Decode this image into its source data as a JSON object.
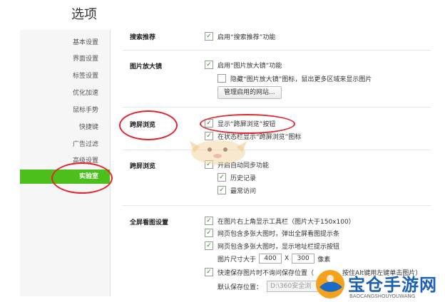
{
  "window": {
    "title": "选项"
  },
  "sidebar": {
    "items": [
      {
        "label": "基本设置"
      },
      {
        "label": "界面设置"
      },
      {
        "label": "标签设置"
      },
      {
        "label": "优化加速"
      },
      {
        "label": "鼠标手势"
      },
      {
        "label": "快捷键"
      },
      {
        "label": "广告过滤"
      },
      {
        "label": "高级设置"
      },
      {
        "label": "实验室",
        "active": true
      }
    ]
  },
  "sections": {
    "search": {
      "title": "搜索推荐",
      "opt1": "启用“搜索推荐”功能"
    },
    "magnifier": {
      "title": "图片放大镜",
      "opt1": "启用“图片放大镜”功能",
      "opt2": "隐藏“图片放大镜”图标，鼠出更多区域来显示图片",
      "button": "管理启用的网站..."
    },
    "crossscreen1": {
      "title": "跨屏浏览",
      "opt1": "显示“跨屏浏览”按钮",
      "opt2": "在状态栏显示“跨屏浏览”图标"
    },
    "crossscreen2": {
      "title": "跨屏浏览",
      "opt1": "开启自动同步功能",
      "opt2": "历史记录",
      "opt3": "最常访问"
    },
    "fullscreen": {
      "title": "全屏看图设置",
      "opt1": "在图片右上角显示工具栏（图片大于150x100）",
      "opt2": "网页包含多张大图时，弹出全屏看图提示条",
      "opt3": "网页包含多张大图时，显示地址栏提示按钮",
      "size_label": "图片尺寸大于",
      "width": "400",
      "x_sep": "X",
      "height": "300",
      "unit": "像素",
      "opt4": "快速保存图片时不询问保存位置（",
      "opt4_tail": "按住Alt键用左键单击图片）",
      "save_path_label": "默认保存位置：",
      "save_path_value": "D:\\360安全浏"
    }
  },
  "watermark": {
    "brand": "宝仓手游网",
    "sub": "BAOCANGSHOUYOUWANG"
  },
  "colors": {
    "accent": "#4cbf1c",
    "annotation": "#e3262c",
    "check": "#2a8b1f"
  }
}
